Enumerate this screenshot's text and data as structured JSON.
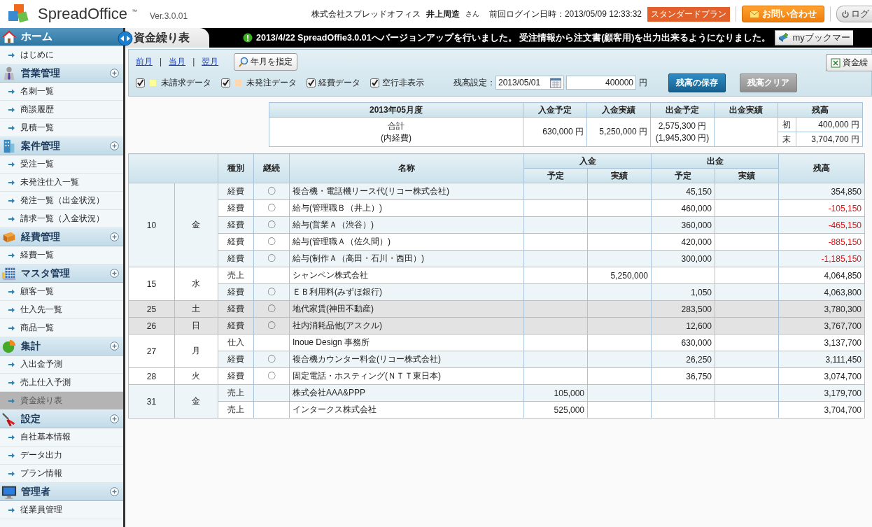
{
  "header": {
    "logo_text": "SpreadOffice",
    "trademark": "™",
    "version": "Ver.3.0.01",
    "company": "株式会社スプレッドオフィス",
    "user": "井上周造",
    "honorific": "さん",
    "last_login": "前回ログイン日時：2013/05/09 12:33:32",
    "plan": "スタンダードプラン",
    "contact_button": "お問い合わせ",
    "logout_button": "ログ"
  },
  "sidebar": {
    "groups": [
      {
        "title": "ホーム",
        "kind": "home",
        "items": [
          {
            "label": "はじめに",
            "selected": false
          }
        ]
      },
      {
        "title": "営業管理",
        "kind": "section",
        "items": [
          {
            "label": "名刺一覧",
            "selected": false
          },
          {
            "label": "商談履歴",
            "selected": false
          },
          {
            "label": "見積一覧",
            "selected": false
          }
        ]
      },
      {
        "title": "案件管理",
        "kind": "section",
        "items": [
          {
            "label": "受注一覧",
            "selected": false
          },
          {
            "label": "未発注仕入一覧",
            "selected": false
          },
          {
            "label": "発注一覧（出金状況）",
            "selected": false
          },
          {
            "label": "請求一覧（入金状況）",
            "selected": false
          }
        ]
      },
      {
        "title": "経費管理",
        "kind": "section",
        "items": [
          {
            "label": "経費一覧",
            "selected": false
          }
        ]
      },
      {
        "title": "マスタ管理",
        "kind": "section",
        "items": [
          {
            "label": "顧客一覧",
            "selected": false
          },
          {
            "label": "仕入先一覧",
            "selected": false
          },
          {
            "label": "商品一覧",
            "selected": false
          }
        ]
      },
      {
        "title": "集計",
        "kind": "section",
        "items": [
          {
            "label": "入出金予測",
            "selected": false
          },
          {
            "label": "売上仕入予測",
            "selected": false
          },
          {
            "label": "資金繰り表",
            "selected": true
          }
        ]
      },
      {
        "title": "設定",
        "kind": "section",
        "items": [
          {
            "label": "自社基本情報",
            "selected": false
          },
          {
            "label": "データ出力",
            "selected": false
          },
          {
            "label": "プラン情報",
            "selected": false
          }
        ]
      },
      {
        "title": "管理者",
        "kind": "section",
        "items": [
          {
            "label": "従業員管理",
            "selected": false
          }
        ]
      }
    ]
  },
  "page": {
    "title": "資金繰り表",
    "notice": "2013/4/22 SpreadOffie3.0.01へバージョンアップを行いました。 受注情報から注文書(顧客用)を出力出来るようになりました。",
    "bookmark_button": "myブックマー"
  },
  "toolbar": {
    "links": [
      {
        "label": "前月"
      },
      {
        "label": "当月"
      },
      {
        "label": "翌月"
      }
    ],
    "separator": "|",
    "month_button": "年月を指定",
    "export_button": "資金繰",
    "filters": [
      {
        "label": "未請求データ",
        "checked": true,
        "color": "#ffff99"
      },
      {
        "label": "未発注データ",
        "checked": true,
        "color": "#ffd8b0"
      },
      {
        "label": "経費データ",
        "checked": true
      },
      {
        "label": "空行非表示",
        "checked": true
      }
    ],
    "balance_label": "残高設定：",
    "date_value": "2013/05/01",
    "amount_value": "400000",
    "unit": "円",
    "buttons": [
      {
        "label": "残高の保存",
        "disabled": false
      },
      {
        "label": "残高クリア",
        "disabled": true
      }
    ]
  },
  "summary": {
    "period": "2013年05月度",
    "columns": [
      "入金予定",
      "入金実績",
      "出金予定",
      "出金実績",
      "残高"
    ],
    "label": "合計",
    "sublabel": "(内経費)",
    "in_plan": "630,000 円",
    "in_actual": "5,250,000 円",
    "out_plan": "2,575,300 円",
    "out_plan_expense": "(1,945,300 円)",
    "opening_label": "初",
    "opening": "400,000 円",
    "closing_label": "末",
    "closing": "3,704,700 円"
  },
  "table": {
    "columns": {
      "type": "種別",
      "recurring": "継続",
      "name": "名称",
      "in": "入金",
      "out": "出金",
      "in_plan": "予定",
      "in_actual": "実績",
      "out_plan": "予定",
      "out_actual": "実績",
      "balance": "残高"
    },
    "days": [
      {
        "day": "10",
        "weekday": "金",
        "weekend": false,
        "rows": [
          {
            "type": "経費",
            "recurring": "〇",
            "name": "複合機・電話機リース代(リコー株式会社)",
            "out_plan": "45,150",
            "balance": "354,850",
            "negative": false
          },
          {
            "type": "経費",
            "recurring": "〇",
            "name": "給与(管理職Ｂ（井上）)",
            "out_plan": "460,000",
            "balance": "-105,150",
            "negative": true
          },
          {
            "type": "経費",
            "recurring": "〇",
            "name": "給与(営業Ａ（渋谷）)",
            "out_plan": "360,000",
            "balance": "-465,150",
            "negative": true
          },
          {
            "type": "経費",
            "recurring": "〇",
            "name": "給与(管理職Ａ（佐久間）)",
            "out_plan": "420,000",
            "balance": "-885,150",
            "negative": true
          },
          {
            "type": "経費",
            "recurring": "〇",
            "name": "給与(制作Ａ（高田・石川・西田）)",
            "out_plan": "300,000",
            "balance": "-1,185,150",
            "negative": true
          }
        ]
      },
      {
        "day": "15",
        "weekday": "水",
        "weekend": false,
        "rows": [
          {
            "type": "売上",
            "name": "シャンペン株式会社",
            "in_actual": "5,250,000",
            "balance": "4,064,850",
            "negative": false
          },
          {
            "type": "経費",
            "recurring": "〇",
            "name": "ＥＢ利用料(みずほ銀行)",
            "out_plan": "1,050",
            "balance": "4,063,800",
            "negative": false
          }
        ]
      },
      {
        "day": "25",
        "weekday": "土",
        "weekend": true,
        "rows": [
          {
            "type": "経費",
            "recurring": "〇",
            "name": "地代家賃(神田不動産)",
            "out_plan": "283,500",
            "balance": "3,780,300",
            "negative": false
          }
        ]
      },
      {
        "day": "26",
        "weekday": "日",
        "weekend": true,
        "rows": [
          {
            "type": "経費",
            "recurring": "〇",
            "name": "社内消耗品他(アスクル)",
            "out_plan": "12,600",
            "balance": "3,767,700",
            "negative": false
          }
        ]
      },
      {
        "day": "27",
        "weekday": "月",
        "weekend": false,
        "rows": [
          {
            "type": "仕入",
            "name": "Inoue Design 事務所",
            "out_plan": "630,000",
            "balance": "3,137,700",
            "negative": false
          },
          {
            "type": "経費",
            "recurring": "〇",
            "name": "複合機カウンター料金(リコー株式会社)",
            "out_plan": "26,250",
            "balance": "3,111,450",
            "negative": false
          }
        ]
      },
      {
        "day": "28",
        "weekday": "火",
        "weekend": false,
        "rows": [
          {
            "type": "経費",
            "recurring": "〇",
            "name": "固定電話・ホスティング(ＮＴＴ東日本)",
            "out_plan": "36,750",
            "balance": "3,074,700",
            "negative": false
          }
        ]
      },
      {
        "day": "31",
        "weekday": "金",
        "weekend": false,
        "rows": [
          {
            "type": "売上",
            "name": "株式会社AAA&PPP",
            "in_plan": "105,000",
            "balance": "3,179,700",
            "negative": false
          },
          {
            "type": "売上",
            "name": "インタークス株式会社",
            "in_plan": "525,000",
            "balance": "3,704,700",
            "negative": false
          }
        ]
      }
    ]
  }
}
